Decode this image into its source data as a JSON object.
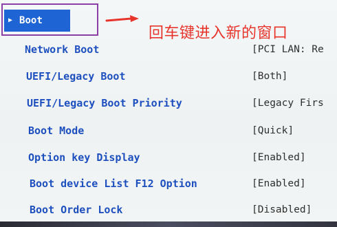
{
  "menu": {
    "boot_tab": "Boot",
    "items": [
      {
        "label": "Network Boot",
        "value": "[PCI LAN: Re"
      },
      {
        "label": "UEFI/Legacy Boot",
        "value": "[Both]"
      },
      {
        "label": "UEFI/Legacy Boot Priority",
        "value": "[Legacy Firs"
      },
      {
        "label": "Boot Mode",
        "value": "[Quick]"
      },
      {
        "label": "Option key Display",
        "value": "[Enabled]"
      },
      {
        "label": "Boot device List F12 Option",
        "value": "[Enabled]"
      },
      {
        "label": "Boot Order Lock",
        "value": "[Disabled]"
      }
    ]
  },
  "annotation": {
    "text": "回车键进入新的窗口",
    "color": "#e8352c",
    "box_color": "#8a3ea6"
  },
  "colors": {
    "label": "#1d4fbf",
    "value": "#2e2e2e",
    "selected_bg": "#1f64d4"
  },
  "icons": {
    "selected_marker": "triangle-right-icon",
    "annotation_arrow": "arrow-right-icon"
  }
}
